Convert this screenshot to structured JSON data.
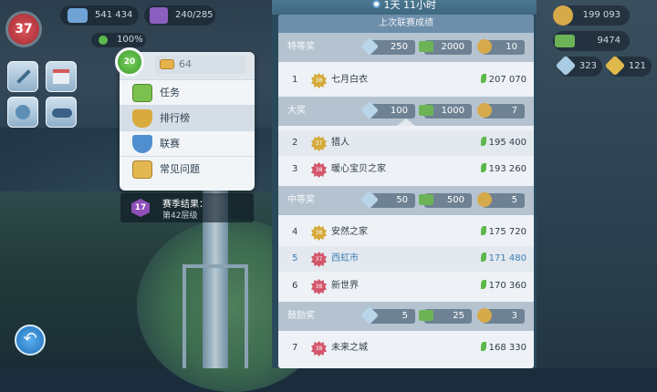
{
  "hud": {
    "player_level": "37",
    "population": "541 434",
    "storage": "240/285",
    "happiness": "100%",
    "simoleons": "199 093",
    "simcash": "9474",
    "keys_a": "323",
    "keys_b": "121"
  },
  "menu": {
    "level": "20",
    "coins": "64",
    "items": [
      {
        "label": "任务",
        "icon": "task-book-icon"
      },
      {
        "label": "排行榜",
        "icon": "trophy-icon",
        "selected": true
      },
      {
        "label": "联赛",
        "icon": "league-shield-icon"
      },
      {
        "label": "常见问题",
        "icon": "faq-book-icon"
      }
    ]
  },
  "season": {
    "badge": "17",
    "title": "赛季结果：",
    "subtitle": "第42层级"
  },
  "board": {
    "timer": "1天 11小时",
    "title": "上次联赛成绩",
    "tiers": [
      {
        "label": "特等奖",
        "keys": "250",
        "cash": "2000",
        "coins": "10"
      },
      {
        "label": "大奖",
        "keys": "100",
        "cash": "1000",
        "coins": "7"
      },
      {
        "label": "中等奖",
        "keys": "50",
        "cash": "500",
        "coins": "5"
      },
      {
        "label": "鼓励奖",
        "keys": "5",
        "cash": "25",
        "coins": "3"
      }
    ],
    "rows": [
      {
        "rank": "1",
        "level": "38",
        "name": "七月白衣",
        "score": "207 070"
      },
      {
        "rank": "2",
        "level": "37",
        "name": "猎人",
        "score": "195 400"
      },
      {
        "rank": "3",
        "level": "38",
        "name": "暖心宝贝之家",
        "score": "193 260"
      },
      {
        "rank": "4",
        "level": "38",
        "name": "安然之家",
        "score": "175 720"
      },
      {
        "rank": "5",
        "level": "37",
        "name": "西虹市",
        "score": "171 480"
      },
      {
        "rank": "6",
        "level": "38",
        "name": "新世界",
        "score": "170 360"
      },
      {
        "rank": "7",
        "level": "38",
        "name": "未来之城",
        "score": "168 330"
      }
    ]
  },
  "colors": {
    "accent": "#3e7fb4",
    "leaf": "#5cb84a",
    "panel": "#2a4a5c"
  }
}
